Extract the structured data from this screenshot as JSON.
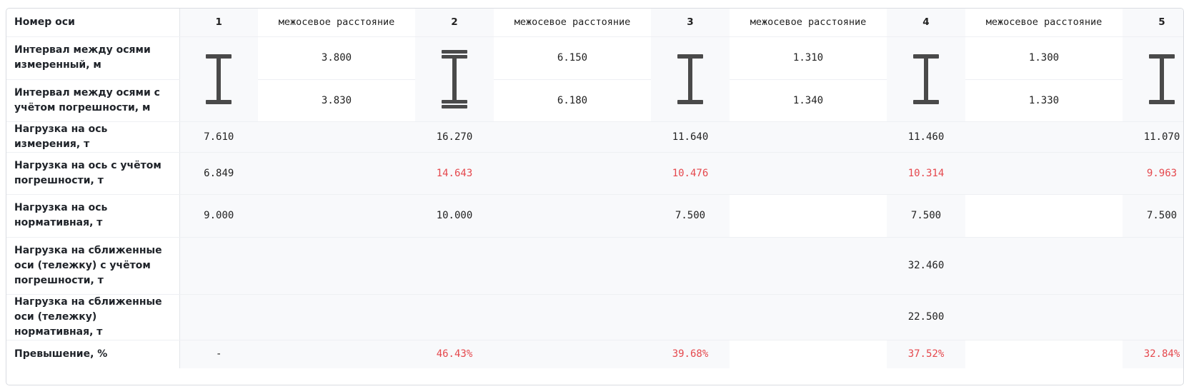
{
  "labels": {
    "axis_number": "Номер оси",
    "interval_measured": "Интервал между осями измеренный, м",
    "interval_error": "Интервал между осями с учётом погрешности, м",
    "load_measured": "Нагрузка на ось измерения, т",
    "load_error": "Нагрузка на ось с учётом погрешности, т",
    "load_norm": "Нагрузка на ось нормативная, т",
    "bogie_error": "Нагрузка на сближенные оси (тележку) с учётом погрешности, т",
    "bogie_norm": "Нагрузка на сближенные оси (тележку) нормативная, т",
    "excess": "Превышение, %"
  },
  "distance_header": "межосевое расстояние",
  "axes": [
    {
      "number": "1",
      "icon": "single-axle-icon",
      "load_measured": "7.610",
      "load_error": "6.849",
      "load_error_exceeds": false,
      "load_norm": "9.000",
      "excess": "-",
      "excess_exceeds": false
    },
    {
      "number": "2",
      "icon": "double-axle-icon",
      "load_measured": "16.270",
      "load_error": "14.643",
      "load_error_exceeds": true,
      "load_norm": "10.000",
      "excess": "46.43%",
      "excess_exceeds": true
    },
    {
      "number": "3",
      "icon": "single-axle-icon",
      "load_measured": "11.640",
      "load_error": "10.476",
      "load_error_exceeds": true,
      "load_norm": "7.500",
      "excess": "39.68%",
      "excess_exceeds": true
    },
    {
      "number": "4",
      "icon": "single-axle-icon",
      "load_measured": "11.460",
      "load_error": "10.314",
      "load_error_exceeds": true,
      "load_norm": "7.500",
      "bogie_error": "32.460",
      "bogie_norm": "22.500",
      "excess": "37.52%",
      "excess_exceeds": true
    },
    {
      "number": "5",
      "icon": "single-axle-icon",
      "load_measured": "11.070",
      "load_error": "9.963",
      "load_error_exceeds": true,
      "load_norm": "7.500",
      "excess": "32.84%",
      "excess_exceeds": true
    }
  ],
  "intervals": [
    {
      "measured": "3.800",
      "with_error": "3.830"
    },
    {
      "measured": "6.150",
      "with_error": "6.180"
    },
    {
      "measured": "1.310",
      "with_error": "1.340"
    },
    {
      "measured": "1.300",
      "with_error": "1.330"
    }
  ],
  "colors": {
    "exceeds": "#e5484d",
    "normal": "#222222",
    "icon": "#4a4a4a"
  }
}
